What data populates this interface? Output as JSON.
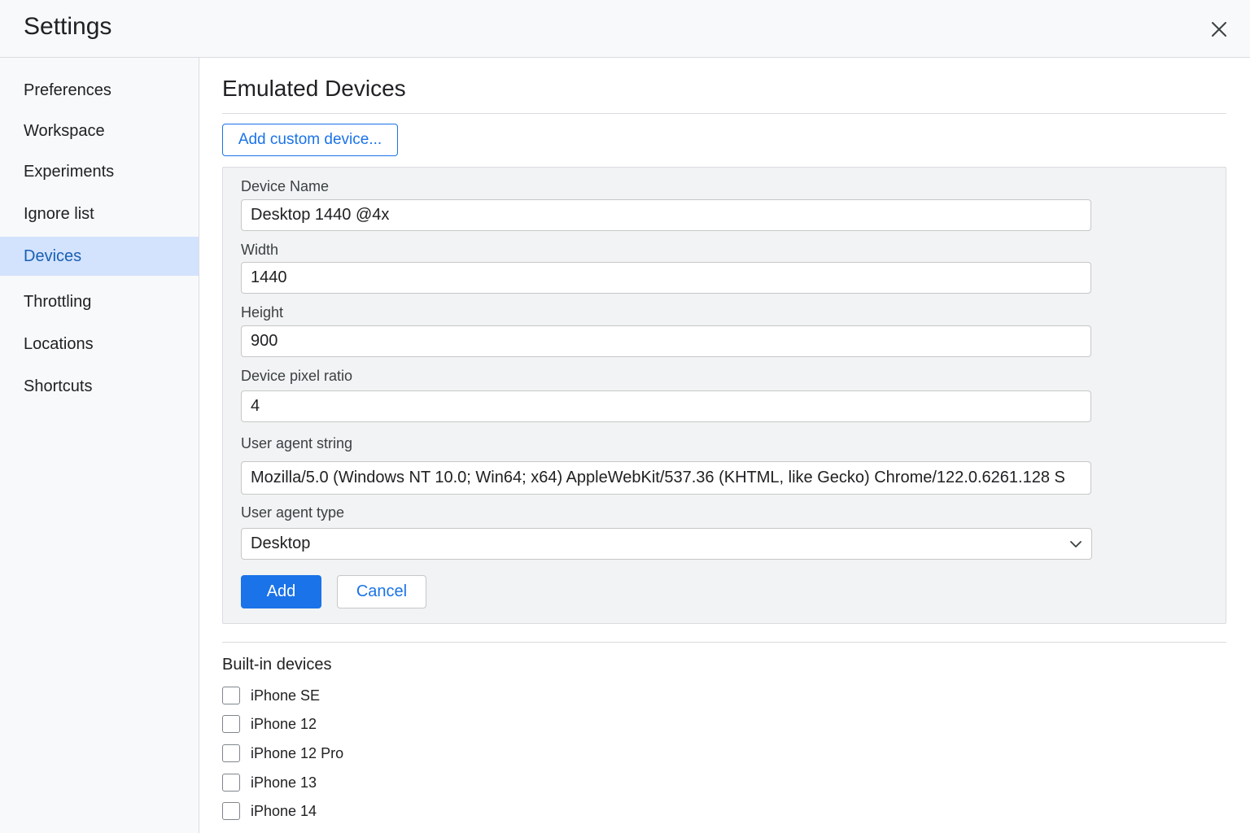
{
  "header": {
    "title": "Settings",
    "close_icon": "close-icon"
  },
  "sidebar": {
    "items": [
      {
        "label": "Preferences",
        "active": false
      },
      {
        "label": "Workspace",
        "active": false
      },
      {
        "label": "Experiments",
        "active": false
      },
      {
        "label": "Ignore list",
        "active": false
      },
      {
        "label": "Devices",
        "active": true
      },
      {
        "label": "Throttling",
        "active": false
      },
      {
        "label": "Locations",
        "active": false
      },
      {
        "label": "Shortcuts",
        "active": false
      }
    ]
  },
  "main": {
    "title": "Emulated Devices",
    "add_custom_label": "Add custom device...",
    "form": {
      "device_name": {
        "label": "Device Name",
        "value": "Desktop 1440 @4x"
      },
      "width": {
        "label": "Width",
        "value": "1440"
      },
      "height": {
        "label": "Height",
        "value": "900"
      },
      "dpr": {
        "label": "Device pixel ratio",
        "value": "4"
      },
      "ua_string": {
        "label": "User agent string",
        "value": "Mozilla/5.0 (Windows NT 10.0; Win64; x64) AppleWebKit/537.36 (KHTML, like Gecko) Chrome/122.0.6261.128 S"
      },
      "ua_type": {
        "label": "User agent type",
        "value": "Desktop"
      },
      "add_label": "Add",
      "cancel_label": "Cancel"
    },
    "builtin": {
      "title": "Built-in devices",
      "devices": [
        {
          "label": "iPhone SE",
          "checked": false
        },
        {
          "label": "iPhone 12",
          "checked": false
        },
        {
          "label": "iPhone 12 Pro",
          "checked": false
        },
        {
          "label": "iPhone 13",
          "checked": false
        },
        {
          "label": "iPhone 14",
          "checked": false
        }
      ]
    }
  },
  "colors": {
    "accent": "#1a73e8",
    "active_nav_bg": "#d3e3fd",
    "panel_bg": "#f1f3f4",
    "border": "#dadce0"
  }
}
